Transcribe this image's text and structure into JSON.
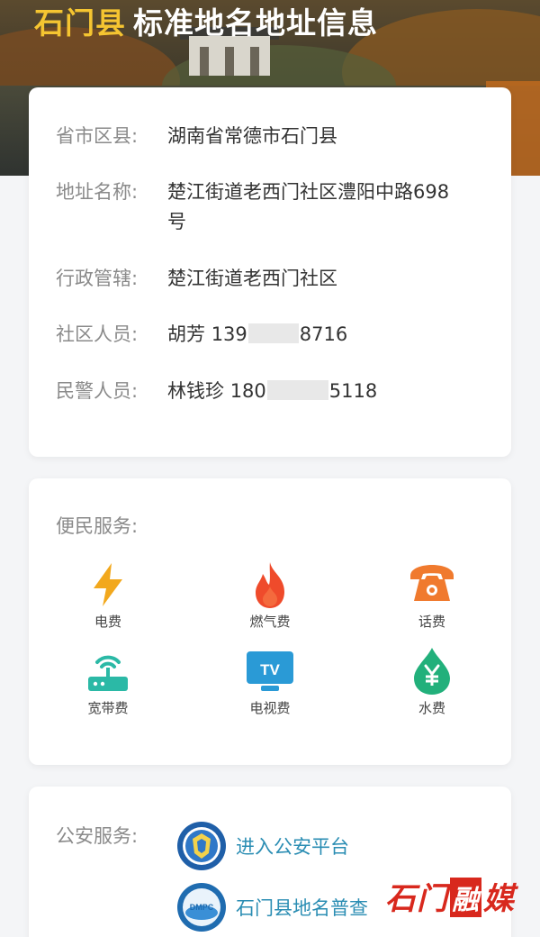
{
  "header": {
    "county": "石门县",
    "title": "标准地名地址信息"
  },
  "address_info": {
    "rows": [
      {
        "label": "省市区县:",
        "value": "湖南省常德市石门县"
      },
      {
        "label": "地址名称:",
        "value_line1": "楚江街道老西门社区澧阳中路698",
        "value_line2": "号"
      },
      {
        "label": "行政管辖:",
        "value": "楚江街道老西门社区"
      },
      {
        "label": "社区人员:",
        "name": "胡芳",
        "phone_prefix": "139",
        "phone_suffix": "8716"
      },
      {
        "label": "民警人员:",
        "name": "林钱珍",
        "phone_prefix": "180",
        "phone_suffix": "5118"
      }
    ]
  },
  "services": {
    "label": "便民服务:",
    "items": [
      {
        "label": "电费",
        "icon": "lightning-icon",
        "color": "#f2a81d"
      },
      {
        "label": "燃气费",
        "icon": "flame-icon",
        "color": "#ef4b2b"
      },
      {
        "label": "话费",
        "icon": "telephone-icon",
        "color": "#f07a2e"
      },
      {
        "label": "宽带费",
        "icon": "router-icon",
        "color": "#2bb9a6"
      },
      {
        "label": "电视费",
        "icon": "tv-icon",
        "color": "#2a9ad6"
      },
      {
        "label": "水费",
        "icon": "water-drop-icon",
        "color": "#22b07b"
      }
    ]
  },
  "police": {
    "label": "公安服务:",
    "items": [
      {
        "label": "进入公安平台",
        "icon": "police-badge-icon"
      },
      {
        "label": "石门县地名普查",
        "icon": "dmpc-badge-icon",
        "badge_text": "DMPC"
      }
    ]
  },
  "watermark": {
    "part1": "石门",
    "part2": "融",
    "part3": "媒"
  },
  "colors": {
    "accent_yellow": "#f5c531",
    "link_blue": "#2a8db3",
    "watermark_red": "#d8281d"
  }
}
